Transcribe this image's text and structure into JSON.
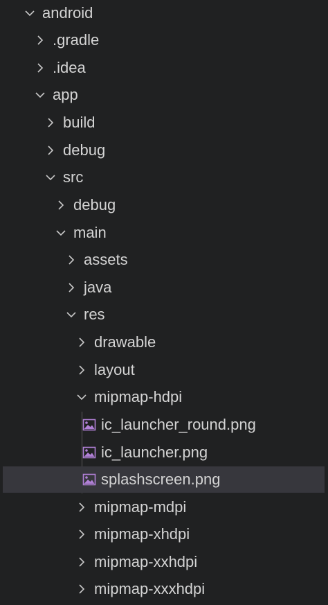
{
  "tree": {
    "android": "android",
    "gradle": ".gradle",
    "idea": ".idea",
    "app": "app",
    "build": "build",
    "debug_app": "debug",
    "src": "src",
    "debug_src": "debug",
    "main": "main",
    "assets": "assets",
    "java": "java",
    "res": "res",
    "drawable": "drawable",
    "layout": "layout",
    "mipmap_hdpi": "mipmap-hdpi",
    "ic_launcher_round": "ic_launcher_round.png",
    "ic_launcher": "ic_launcher.png",
    "splashscreen": "splashscreen.png",
    "mipmap_mdpi": "mipmap-mdpi",
    "mipmap_xhdpi": "mipmap-xhdpi",
    "mipmap_xxhdpi": "mipmap-xxhdpi",
    "mipmap_xxxhdpi": "mipmap-xxxhdpi"
  },
  "icons": {
    "expanded": "chevron-down-icon",
    "collapsed": "chevron-right-icon",
    "image_file": "image-file-icon"
  },
  "colors": {
    "background": "#202122",
    "text": "#d4d4d4",
    "selection": "#37373d",
    "image_icon": "#b180d7"
  }
}
